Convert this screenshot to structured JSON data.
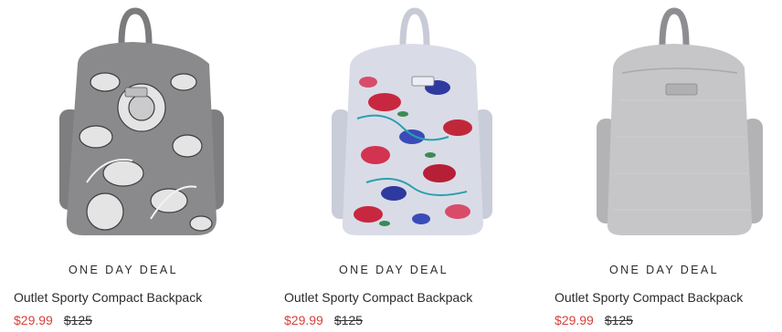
{
  "products": [
    {
      "deal_label": "ONE DAY DEAL",
      "name": "Outlet Sporty Compact Backpack",
      "sale_price": "$29.99",
      "original_price": "$125",
      "image": "gray-white-floral-backpack"
    },
    {
      "deal_label": "ONE DAY DEAL",
      "name": "Outlet Sporty Compact Backpack",
      "sale_price": "$29.99",
      "original_price": "$125",
      "image": "lavender-red-floral-backpack"
    },
    {
      "deal_label": "ONE DAY DEAL",
      "name": "Outlet Sporty Compact Backpack",
      "sale_price": "$29.99",
      "original_price": "$125",
      "image": "light-gray-heather-backpack"
    }
  ],
  "colors": {
    "sale_price": "#d6403a",
    "text": "#2a2a2a"
  }
}
